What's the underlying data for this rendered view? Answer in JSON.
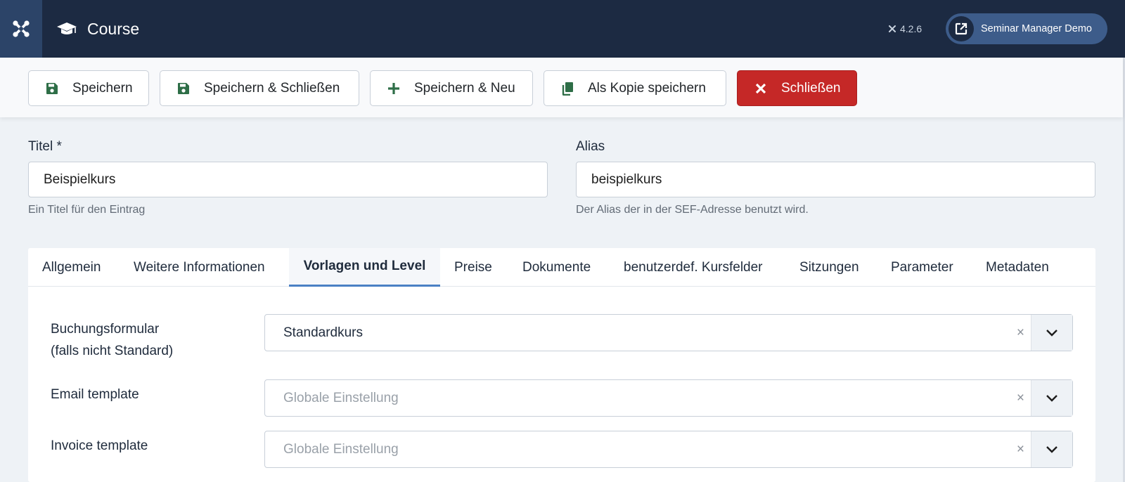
{
  "header": {
    "title": "Course",
    "version": "4.2.6",
    "site_button": "Seminar Manager Demo",
    "icons": {
      "logo": "joomla-logo-icon",
      "title": "graduation-cap-icon",
      "site": "external-link-icon"
    }
  },
  "toolbar": {
    "save": "Speichern",
    "save_close": "Speichern & Schließen",
    "save_new": "Speichern & Neu",
    "save_copy": "Als Kopie speichern",
    "close": "Schließen"
  },
  "form": {
    "title": {
      "label": "Titel *",
      "value": "Beispielkurs",
      "hint": "Ein Titel für den Eintrag"
    },
    "alias": {
      "label": "Alias",
      "value": "beispielkurs",
      "hint": "Der Alias der in der SEF-Adresse benutzt wird."
    }
  },
  "tabs": [
    {
      "label": "Allgemein"
    },
    {
      "label": "Weitere Informationen"
    },
    {
      "label": "Vorlagen und Level"
    },
    {
      "label": "Preise"
    },
    {
      "label": "Dokumente"
    },
    {
      "label": "benutzerdef. Kursfelder"
    },
    {
      "label": "Sitzungen"
    },
    {
      "label": "Parameter"
    },
    {
      "label": "Metadaten"
    }
  ],
  "active_tab": "Vorlagen und Level",
  "fields": {
    "booking_form": {
      "label_line1": "Buchungsformular",
      "label_line2": "(falls nicht Standard)",
      "value": "Standardkurs"
    },
    "email_template": {
      "label": "Email template",
      "placeholder": "Globale Einstellung"
    },
    "invoice_template": {
      "label": "Invoice template",
      "placeholder": "Globale Einstellung"
    },
    "clear_glyph": "×"
  },
  "colors": {
    "header_bg": "#1c2a42",
    "danger": "#c52827",
    "save_icon": "#2e6e47",
    "tab_active": "#4a80c4"
  }
}
